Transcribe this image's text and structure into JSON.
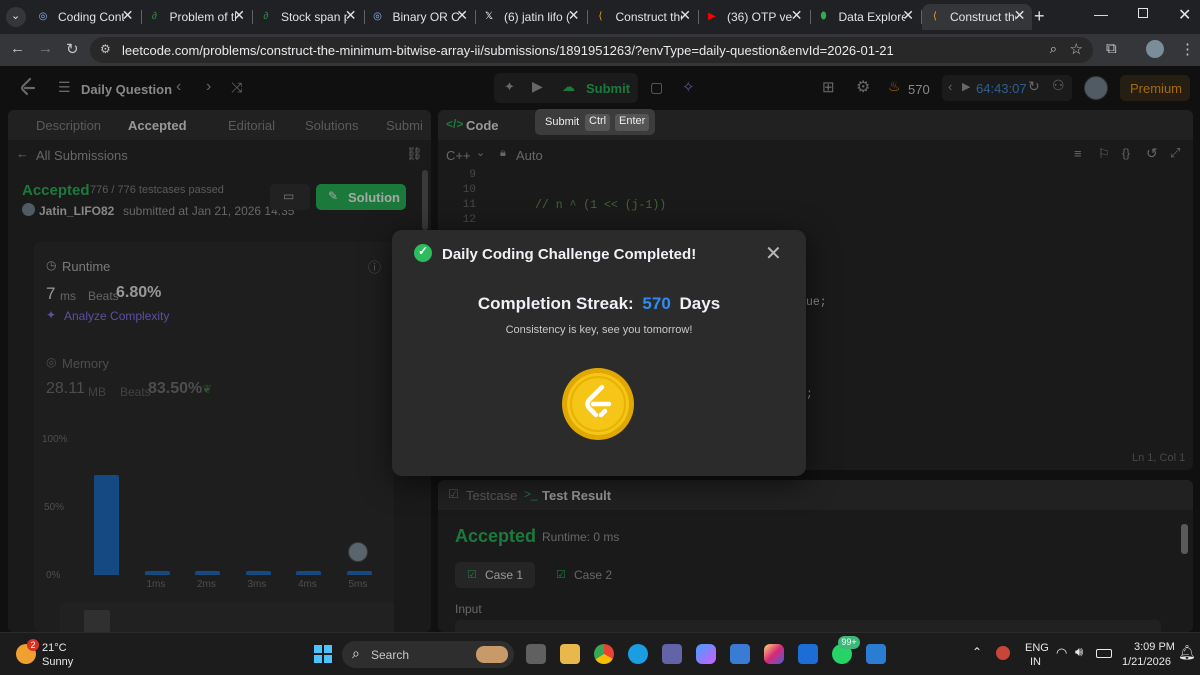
{
  "browser": {
    "tabs": [
      {
        "label": "Coding Conte",
        "icon": "globe-icon"
      },
      {
        "label": "Problem of th",
        "icon": "gfg-icon"
      },
      {
        "label": "Stock span pr",
        "icon": "gfg-icon"
      },
      {
        "label": "Binary OR Ca",
        "icon": "globe-icon"
      },
      {
        "label": "(6) jatin lifo (",
        "icon": "x-icon"
      },
      {
        "label": "Construct the",
        "icon": "leetcode-icon"
      },
      {
        "label": "(36) OTP verif",
        "icon": "youtube-icon"
      },
      {
        "label": "Data Explorer",
        "icon": "drop-icon"
      },
      {
        "label": "Construct the",
        "icon": "leetcode-icon"
      }
    ],
    "url": "leetcode.com/problems/construct-the-minimum-bitwise-array-ii/submissions/1891951263/?envType=daily-question&envId=2026-01-21"
  },
  "nav": {
    "daily_question": "Daily Question",
    "submit": "Submit",
    "streak_count": "570",
    "timer": "64:43:07",
    "premium": "Premium"
  },
  "tooltip": {
    "label": "Submit",
    "key1": "Ctrl",
    "key2": "Enter"
  },
  "left": {
    "tabs": [
      "Description",
      "Accepted",
      "Editorial",
      "Solutions",
      "Submi"
    ],
    "all_submissions": "All Submissions",
    "status": "Accepted",
    "testcases": "776 / 776 testcases passed",
    "user": "Jatin_LIFO82",
    "submitted": "submitted at Jan 21, 2026 14:35",
    "solution_btn": "Solution",
    "runtime_title": "Runtime",
    "runtime_value": "7",
    "runtime_unit": "ms",
    "runtime_beats_label": "Beats",
    "runtime_beats": "6.80%",
    "analyze": "Analyze Complexity",
    "memory_title": "Memory",
    "memory_value": "28.11",
    "memory_unit": "MB",
    "memory_beats_label": "Beats",
    "memory_beats": "83.50%"
  },
  "chart_data": {
    "type": "bar",
    "categories": [
      "",
      "1ms",
      "2ms",
      "3ms",
      "4ms",
      "5ms"
    ],
    "values": [
      77,
      2,
      2,
      2,
      3,
      2
    ],
    "y_ticks": [
      "100%",
      "50%",
      "0%"
    ],
    "ylim": [
      0,
      100
    ],
    "bar_color": "#2170c8"
  },
  "editor": {
    "title": "Code",
    "lang": "C++",
    "auto": "Auto",
    "lines": [
      {
        "num": "9",
        "code": "// n ^ (1 << (j-1))"
      },
      {
        "num": "10",
        "code": "int n = nums.size();"
      },
      {
        "num": "11",
        "code": "vector<int> ans(n, -1);"
      },
      {
        "num": "12",
        "code": ""
      }
    ],
    "frag1": "ue;",
    "frag2": ";",
    "cursor": "Ln 1, Col 1"
  },
  "bottom": {
    "tab1": "Testcase",
    "tab2": "Test Result",
    "status": "Accepted",
    "runtime": "Runtime: 0 ms",
    "case1": "Case 1",
    "case2": "Case 2",
    "input": "Input"
  },
  "modal": {
    "title": "Daily Coding Challenge Completed!",
    "streak_label": "Completion Streak:",
    "streak_value": "570",
    "streak_unit": "Days",
    "message": "Consistency is key, see you tomorrow!"
  },
  "taskbar": {
    "weather_temp": "21°C",
    "weather_desc": "Sunny",
    "weather_badge": "2",
    "search": "Search",
    "notif_badge": "99+",
    "lang1": "ENG",
    "lang2": "IN",
    "time": "3:09 PM",
    "date": "1/21/2026"
  },
  "colors": {
    "accent_green": "#2cbb5d",
    "accent_blue": "#2f8cf6",
    "orange": "#ffa116",
    "coin": "#f5c518"
  }
}
